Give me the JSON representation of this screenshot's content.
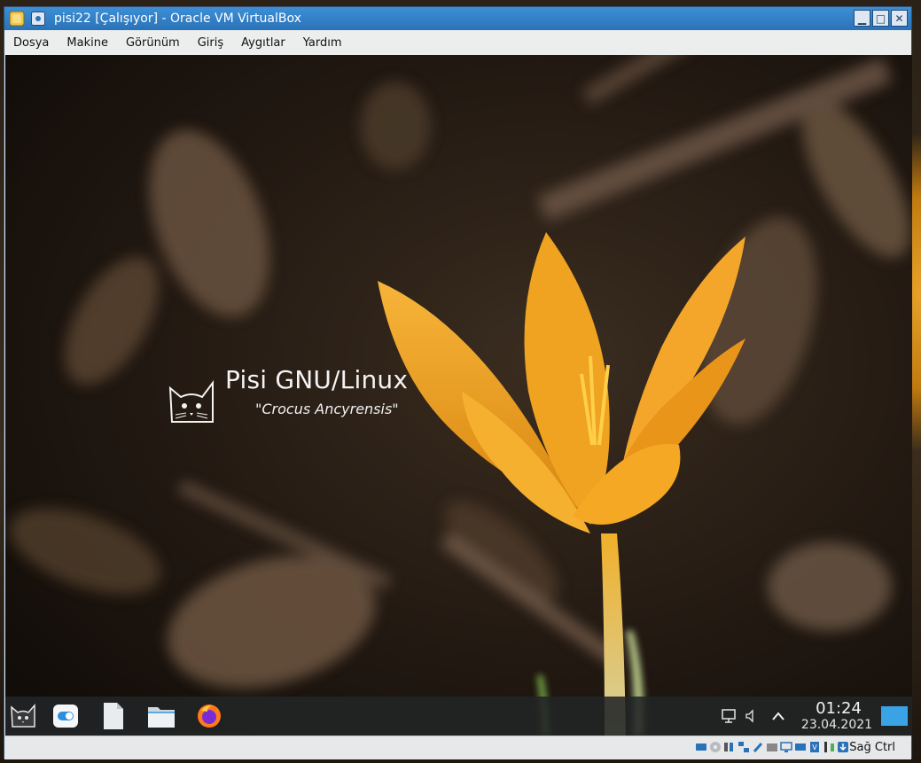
{
  "window": {
    "title": "pisi22 [Çalışıyor] - Oracle VM VirtualBox",
    "controls": [
      "minimize",
      "maximize",
      "close"
    ]
  },
  "menubar": {
    "items": [
      "Dosya",
      "Makine",
      "Görünüm",
      "Giriş",
      "Aygıtlar",
      "Yardım"
    ]
  },
  "guest": {
    "wallpaper_logo": {
      "title": "Pisi GNU/Linux",
      "subtitle": "\"Crocus Ancyrensis\""
    },
    "taskbar": {
      "apps": [
        "pisi-menu-icon",
        "settings-toggle-icon",
        "document-icon",
        "file-manager-icon",
        "firefox-icon"
      ],
      "tray": [
        "network-icon",
        "volume-icon",
        "expand-tray-icon"
      ],
      "clock_time": "01:24",
      "clock_date": "23.04.2021"
    }
  },
  "statusbar": {
    "host_key_label": "Sağ Ctrl",
    "icons": [
      "hard-disk-icon",
      "optical-drive-icon",
      "audio-icon",
      "network-adapter-icon",
      "usb-icon",
      "shared-folders-icon",
      "display-icon",
      "video-capture-icon",
      "cpu-indicator-icon",
      "mouse-integration-icon",
      "keyboard-capture-icon"
    ]
  },
  "colors": {
    "titlebar": "#2a72b8",
    "flower": "#f0a020",
    "taskbar": "#222426"
  }
}
